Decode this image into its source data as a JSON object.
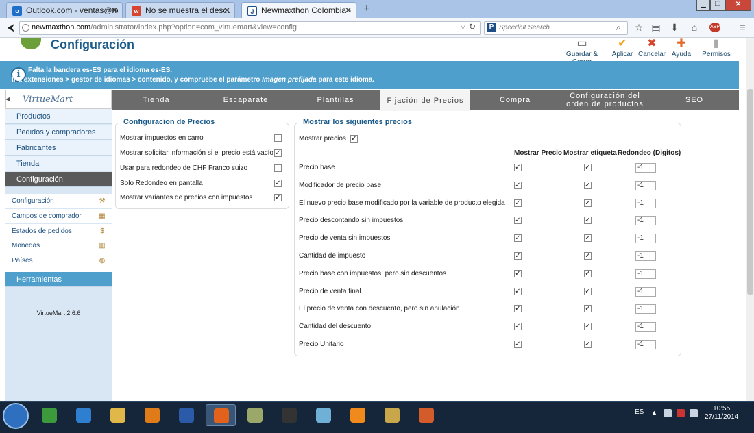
{
  "browser": {
    "tabs": [
      {
        "title": "Outlook.com - ventas@ne...",
        "icon": "outlook-icon",
        "icon_label": "o"
      },
      {
        "title": "No se muestra el descuent...",
        "icon": "webpage-icon",
        "icon_label": "w"
      },
      {
        "title": "Newmaxthon Colombia - ...",
        "icon": "joomla-icon",
        "icon_label": "J"
      }
    ],
    "new_tab": "+",
    "url_host": "newmaxthon.com",
    "url_path": "/administrator/index.php?option=com_virtuemart&view=config",
    "search_placeholder": "Speedbit Search"
  },
  "header": {
    "title": "Configuración",
    "toolbar": [
      {
        "label": "Guardar & Cerrar",
        "icon": "save-close-icon"
      },
      {
        "label": "Aplicar",
        "icon": "apply-check-icon"
      },
      {
        "label": "Cancelar",
        "icon": "cancel-icon"
      },
      {
        "label": "Ayuda",
        "icon": "help-icon"
      },
      {
        "label": "Permisos",
        "icon": "permissions-icon"
      }
    ]
  },
  "message": {
    "line1": "Falta la bandera es-ES para el idioma es-ES.",
    "line2_a": "Ir a extensiones > gestor de idiomas > contenido, y compruebe el parámetro ",
    "line2_em": "Imagen prefijada",
    "line2_b": " para este idioma."
  },
  "sidebar": {
    "logo": "VirtueMart",
    "nav": [
      {
        "label": "Productos"
      },
      {
        "label": "Pedidos y compradores"
      },
      {
        "label": "Fabricantes"
      },
      {
        "label": "Tienda"
      },
      {
        "label": "Configuración",
        "active": true
      }
    ],
    "subnav": [
      {
        "label": "Configuración",
        "icon": "tools-icon"
      },
      {
        "label": "Campos de comprador",
        "icon": "form-icon"
      },
      {
        "label": "Estados de pedidos",
        "icon": "status-icon"
      },
      {
        "label": "Monedas",
        "icon": "coins-icon"
      },
      {
        "label": "Países",
        "icon": "globe-icon"
      }
    ],
    "tools": "Herramientas",
    "version": "VirtueMart 2.6.6"
  },
  "tabs": [
    {
      "label": "Tienda"
    },
    {
      "label": "Escaparate"
    },
    {
      "label": "Plantillas"
    },
    {
      "label": "Fijación de Precios",
      "active": true
    },
    {
      "label": "Compra"
    },
    {
      "label": "Configuración del orden de productos"
    },
    {
      "label": "SEO"
    }
  ],
  "price_config": {
    "legend": "Configuracion de Precios",
    "rows": [
      {
        "label": "Mostrar impuestos en carro",
        "checked": false
      },
      {
        "label": "Mostrar solicitar información si el precio está vacío",
        "checked": true
      },
      {
        "label": "Usar para redondeo de CHF Franco suizo",
        "checked": false
      },
      {
        "label": "Solo Redondeo en pantalla",
        "checked": true
      },
      {
        "label": "Mostrar variantes de precios con impuestos",
        "checked": true
      }
    ]
  },
  "show_prices": {
    "legend": "Mostrar los siguientes precios",
    "show_label": "Mostrar precios",
    "show_checked": true,
    "col_price": "Mostrar Precio",
    "col_label": "Mostrar etiqueta",
    "col_round": "Redondeo (Digitos)",
    "rows": [
      {
        "label": "Precio base",
        "price": true,
        "tag": true,
        "round": "-1"
      },
      {
        "label": "Modificador de precio base",
        "price": true,
        "tag": true,
        "round": "-1"
      },
      {
        "label": "El nuevo precio base modificado por la variable de producto elegida",
        "price": true,
        "tag": true,
        "round": "-1"
      },
      {
        "label": "Precio descontando sin impuestos",
        "price": true,
        "tag": true,
        "round": "-1"
      },
      {
        "label": "Precio de venta sin impuestos",
        "price": true,
        "tag": true,
        "round": "-1"
      },
      {
        "label": "Cantidad de impuesto",
        "price": true,
        "tag": true,
        "round": "-1"
      },
      {
        "label": "Precio base con impuestos, pero sin descuentos",
        "price": true,
        "tag": true,
        "round": "-1"
      },
      {
        "label": "Precio de venta final",
        "price": true,
        "tag": true,
        "round": "-1"
      },
      {
        "label": "El precio de venta con descuento, pero sin anulación",
        "price": true,
        "tag": true,
        "round": "-1"
      },
      {
        "label": "Cantidad del descuento",
        "price": true,
        "tag": true,
        "round": "-1"
      },
      {
        "label": "Precio Unitario",
        "price": true,
        "tag": true,
        "round": "-1"
      }
    ]
  },
  "taskbar": {
    "lang": "ES",
    "time": "10:55",
    "date": "27/11/2014",
    "apps": [
      {
        "name": "chrome-icon",
        "color": "#3c9a3c"
      },
      {
        "name": "internet-explorer-icon",
        "color": "#2f7fd1"
      },
      {
        "name": "file-explorer-icon",
        "color": "#e0b84a"
      },
      {
        "name": "media-player-icon",
        "color": "#e07b1a"
      },
      {
        "name": "word-icon",
        "color": "#2b5aa8"
      },
      {
        "name": "firefox-icon",
        "color": "#e2621b",
        "running": true
      },
      {
        "name": "recycle-app-icon",
        "color": "#9aa86a"
      },
      {
        "name": "inkscape-icon",
        "color": "#333"
      },
      {
        "name": "notepad-icon",
        "color": "#6fb0d6"
      },
      {
        "name": "n-app-icon",
        "color": "#f08a1c"
      },
      {
        "name": "coin-app-icon",
        "color": "#c8a64a"
      },
      {
        "name": "paint-icon",
        "color": "#d35c2a"
      }
    ]
  }
}
